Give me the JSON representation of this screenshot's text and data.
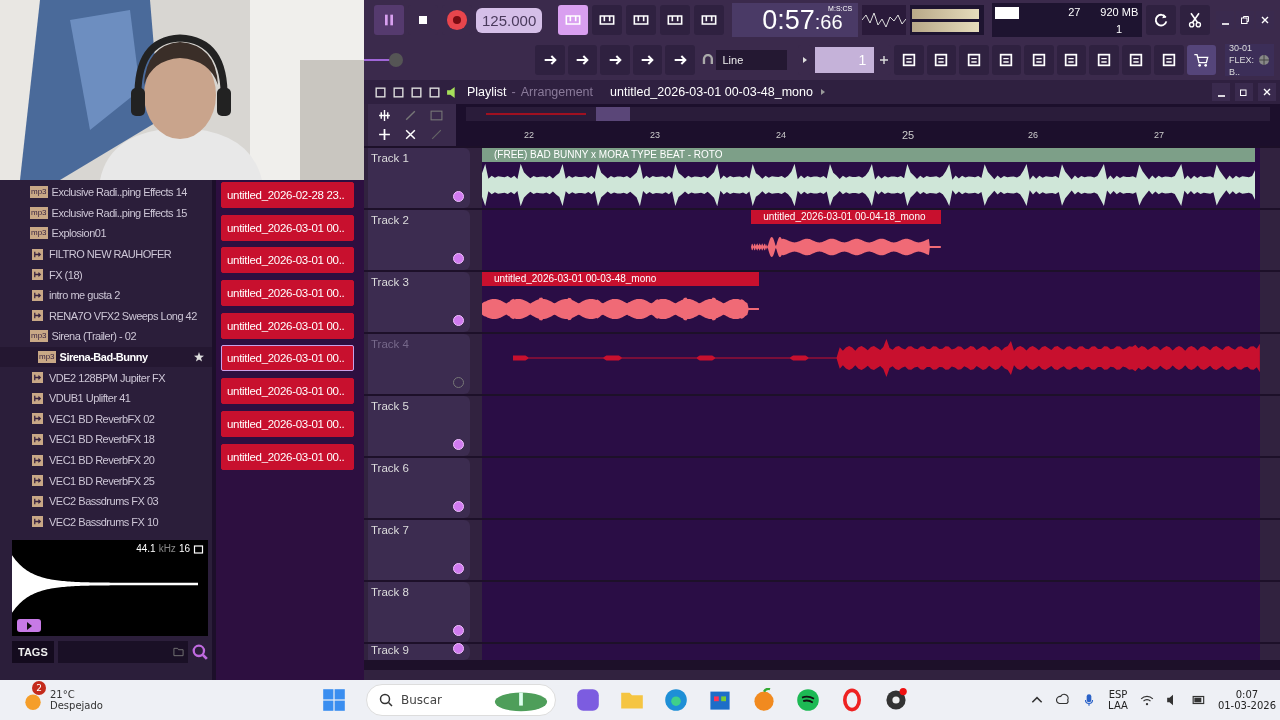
{
  "toolbar": {
    "tempo": "125.000",
    "time": "0:57",
    "time_cs": ":66",
    "time_format": "M:S:CS",
    "cpu": "27",
    "memory": "920 MB",
    "polyphony": "1",
    "snap": "Line",
    "pattern": "1",
    "hint_date": "30-01",
    "hint_text": "FLEX: B..",
    "master_slider": {
      "level": 0.3
    }
  },
  "playlist": {
    "title": "Playlist",
    "separator": "-",
    "view": "Arrangement",
    "pattern": "untitled_2026-03-01 00-03-48_mono"
  },
  "ruler": [
    "22",
    "23",
    "24",
    "25",
    "26",
    "27"
  ],
  "tracks": [
    {
      "name": "Track 1",
      "muted": false,
      "clips": [
        {
          "label": "(FREE) BAD BUNNY x MORA TYPE BEAT - ROTO",
          "color": "#7d9f88"
        }
      ]
    },
    {
      "name": "Track 2",
      "muted": false,
      "clips": [
        {
          "label": "untitled_2026-03-01 00-04-18_mono",
          "color": "#c8102e"
        }
      ]
    },
    {
      "name": "Track 3",
      "muted": false,
      "clips": [
        {
          "label": "untitled_2026-03-01 00-03-48_mono",
          "color": "#c8102e"
        }
      ]
    },
    {
      "name": "Track 4",
      "muted": true,
      "clips": [
        {
          "color": "#c8102e"
        }
      ]
    },
    {
      "name": "Track 5",
      "muted": false
    },
    {
      "name": "Track 6",
      "muted": false
    },
    {
      "name": "Track 7",
      "muted": false
    },
    {
      "name": "Track 8",
      "muted": false
    },
    {
      "name": "Track 9",
      "muted": false
    }
  ],
  "browser": {
    "items": [
      {
        "kind": "audio",
        "badge": "mp3",
        "name": "Exclusive Radi..ping Effects 14",
        "selected": false,
        "starred": false
      },
      {
        "kind": "audio",
        "badge": "mp3",
        "name": "Exclusive Radi..ping Effects 15",
        "selected": false,
        "starred": false
      },
      {
        "kind": "audio",
        "badge": "mp3",
        "name": "Explosion01",
        "selected": false,
        "starred": false
      },
      {
        "kind": "clip",
        "name": "FILTRO NEW RAUHOFER",
        "selected": false,
        "starred": false
      },
      {
        "kind": "clip",
        "name": "FX (18)",
        "selected": false,
        "starred": false
      },
      {
        "kind": "clip",
        "name": "intro me gusta 2",
        "selected": false,
        "starred": false
      },
      {
        "kind": "clip",
        "name": "RENA7O VFX2 Sweeps Long 42",
        "selected": false,
        "starred": false
      },
      {
        "kind": "audio",
        "badge": "mp3",
        "name": "Sirena (Trailer) - 02",
        "selected": false,
        "starred": false
      },
      {
        "kind": "audio",
        "badge": "mp3",
        "name": "Sirena-Bad-Bunny",
        "selected": true,
        "starred": true
      },
      {
        "kind": "clip",
        "name": "VDE2 128BPM Jupiter FX",
        "selected": false,
        "starred": false
      },
      {
        "kind": "clip",
        "name": "VDUB1 Uplifter 41",
        "selected": false,
        "starred": false
      },
      {
        "kind": "clip",
        "name": "VEC1 BD ReverbFX 02",
        "selected": false,
        "starred": false
      },
      {
        "kind": "clip",
        "name": "VEC1 BD ReverbFX 18",
        "selected": false,
        "starred": false
      },
      {
        "kind": "clip",
        "name": "VEC1 BD ReverbFX 20",
        "selected": false,
        "starred": false
      },
      {
        "kind": "clip",
        "name": "VEC1 BD ReverbFX 25",
        "selected": false,
        "starred": false
      },
      {
        "kind": "clip",
        "name": "VEC2 Bassdrums FX 03",
        "selected": false,
        "starred": false
      },
      {
        "kind": "clip",
        "name": "VEC2 Bassdrums FX 10",
        "selected": false,
        "starred": false
      }
    ]
  },
  "recent_clips": [
    {
      "name": "untitled_2026-02-28 23..",
      "selected": false
    },
    {
      "name": "untitled_2026-03-01 00..",
      "selected": false
    },
    {
      "name": "untitled_2026-03-01 00..",
      "selected": false
    },
    {
      "name": "untitled_2026-03-01 00..",
      "selected": false
    },
    {
      "name": "untitled_2026-03-01 00..",
      "selected": false
    },
    {
      "name": "untitled_2026-03-01 00..",
      "selected": true
    },
    {
      "name": "untitled_2026-03-01 00..",
      "selected": false
    },
    {
      "name": "untitled_2026-03-01 00..",
      "selected": false
    },
    {
      "name": "untitled_2026-03-01 00..",
      "selected": false
    }
  ],
  "preview": {
    "rate": "44.1",
    "unit": "kHz",
    "bits": "16"
  },
  "tags": {
    "label": "TAGS"
  },
  "taskbar": {
    "weather_badge": "2",
    "temperature": "21°C",
    "condition": "Despejado",
    "search_placeholder": "Buscar",
    "language": "ESP",
    "layout": "LAA",
    "time": "0:07",
    "date": "01-03-2026"
  }
}
